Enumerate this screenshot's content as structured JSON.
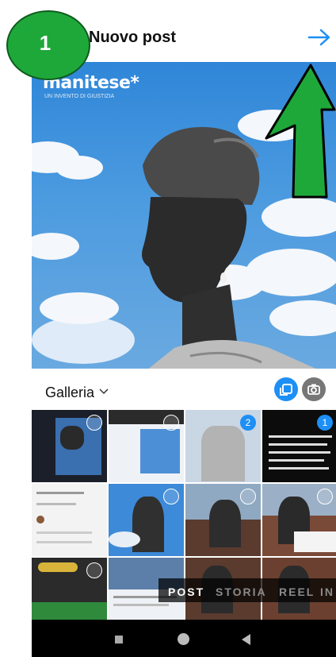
{
  "step_number": "1",
  "header": {
    "title": "Nuovo post"
  },
  "preview": {
    "brand_name": "manitese*",
    "brand_tagline": "UN INVENTO DI GIUSTIZIA"
  },
  "gallery": {
    "label": "Galleria"
  },
  "grid": {
    "selected_badges": [
      "2",
      "1"
    ]
  },
  "modes": [
    "POST",
    "STORIA",
    "REEL",
    "IN"
  ],
  "colors": {
    "accent": "#1d8ff5",
    "pointer_green": "#1fa83a"
  }
}
